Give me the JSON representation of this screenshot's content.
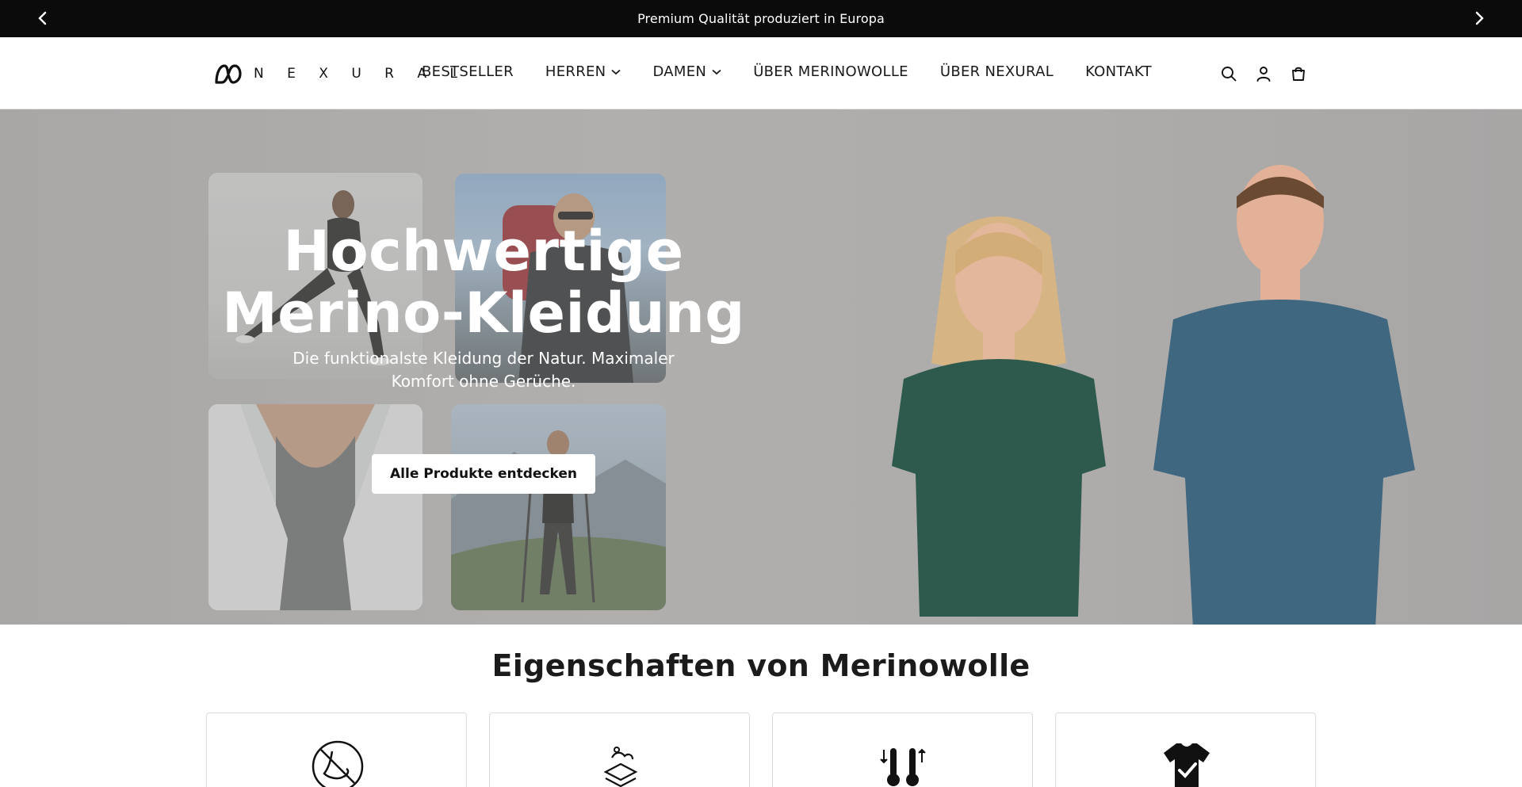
{
  "announcement": {
    "text": "Premium Qualität produziert in Europa",
    "prev_icon": "chevron-left-icon",
    "next_icon": "chevron-right-icon"
  },
  "header": {
    "logo_text": "N E X U R A L",
    "nav": [
      {
        "label": "BESTSELLER",
        "has_dropdown": false
      },
      {
        "label": "HERREN",
        "has_dropdown": true
      },
      {
        "label": "DAMEN",
        "has_dropdown": true
      },
      {
        "label": "ÜBER MERINOWOLLE",
        "has_dropdown": false
      },
      {
        "label": "ÜBER NEXURAL",
        "has_dropdown": false
      },
      {
        "label": "KONTAKT",
        "has_dropdown": false
      }
    ],
    "icons": [
      "search-icon",
      "account-icon",
      "cart-icon"
    ]
  },
  "hero": {
    "title_line1": "Hochwertige",
    "title_line2": "Merino-Kleidung",
    "subtitle": "Die funktionalste Kleidung der Natur. Maximaler Komfort ohne Gerüche.",
    "cta": "Alle Produkte entdecken"
  },
  "features": {
    "title": "Eigenschaften von Merinowolle",
    "cards": [
      {
        "icon": "odor-free-icon"
      },
      {
        "icon": "soft-layers-icon"
      },
      {
        "icon": "temperature-regulation-icon"
      },
      {
        "icon": "shirt-check-icon"
      }
    ]
  },
  "colors": {
    "announcement_bg": "#0b0b0b",
    "hero_bg": "#adabaa",
    "women_shirt": "#2e5a4e",
    "men_shirt": "#3f6780"
  }
}
